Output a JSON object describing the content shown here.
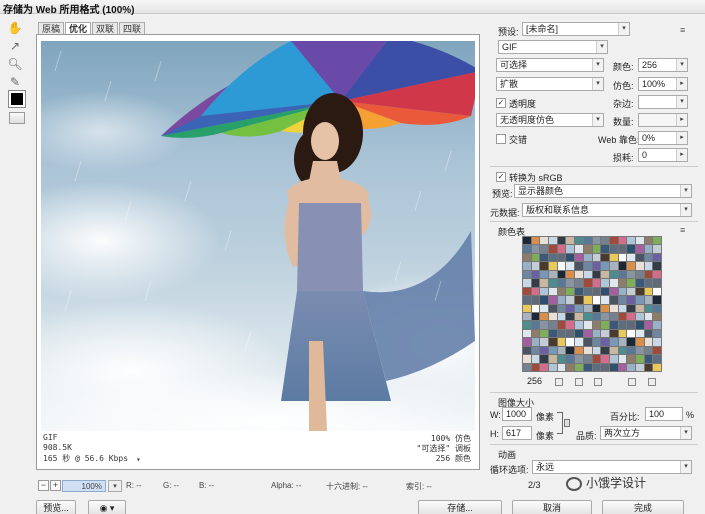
{
  "window": {
    "title": "存储为 Web 所用格式 (100%)"
  },
  "tools": [
    "hand-tool",
    "slice-select-tool",
    "zoom-tool",
    "eyedropper-tool"
  ],
  "tabs": [
    {
      "label": "原稿",
      "active": false
    },
    {
      "label": "优化",
      "active": true
    },
    {
      "label": "双联",
      "active": false
    },
    {
      "label": "四联",
      "active": false
    }
  ],
  "image_info": {
    "format": "GIF",
    "size": "908.5K",
    "time": "165 秒 @ 56.6 Kbps",
    "dither_pct": "100% 仿色",
    "palette": "\"可选择\" 调板",
    "colors": "256 颜色"
  },
  "status": {
    "zoom": "100%",
    "r": "R: --",
    "g": "G: --",
    "b": "B: --",
    "alpha": "Alpha: --",
    "hex": "十六进制: --",
    "index": "索引: --"
  },
  "bottom_buttons": {
    "preview": "预览...",
    "save": "存储...",
    "cancel": "取消",
    "done": "完成"
  },
  "settings": {
    "preset_label": "预设:",
    "preset_value": "[未命名]",
    "format": "GIF",
    "reduction": "可选择",
    "dither_algo": "扩散",
    "colors_label": "颜色:",
    "colors_value": "256",
    "dither_label": "仿色:",
    "dither_value": "100%",
    "transparency_label": "透明度",
    "transparency_checked": true,
    "matte_label": "杂边:",
    "trans_dither": "无透明度仿色",
    "amount_label": "数量:",
    "interlaced_label": "交错",
    "interlaced_checked": false,
    "websnap_label": "Web 靠色:",
    "websnap_value": "0%",
    "lossy_label": "损耗:",
    "lossy_value": "0",
    "convert_srgb_label": "转换为 sRGB",
    "convert_srgb_checked": true,
    "preview_label": "预览:",
    "preview_value": "显示器颜色",
    "metadata_label": "元数据:",
    "metadata_value": "版权和联系信息"
  },
  "color_table": {
    "title": "颜色表",
    "count": "256",
    "colors": [
      "#1c2836",
      "#4b3a2e",
      "#8c7d6a",
      "#c9b8a1",
      "#6e86a0",
      "#2f4f6e",
      "#a04a3b",
      "#d98e4a",
      "#e8c95a",
      "#7fae5b",
      "#4d8d8f",
      "#6b5fa6",
      "#a35fa0",
      "#d66c8c",
      "#e8e0d6",
      "#fdfdfd",
      "#3a5878",
      "#587898",
      "#7898b8",
      "#98b0c8",
      "#b0c4d8",
      "#c8d8e6",
      "#dde7ef",
      "#5d6e7e",
      "#8795a3",
      "#a7b3bf",
      "#c3cdd6",
      "#e0e6eb",
      "#343c48",
      "#4a5462",
      "#606a78",
      "#76808e"
    ],
    "meta_label": "",
    "icons": [
      "map-to-web-icon",
      "lock-color-icon",
      "web-shift-icon",
      "new-color-icon",
      "delete-color-icon"
    ]
  },
  "image_size": {
    "title": "图像大小",
    "w_label": "W:",
    "w_value": "1000",
    "h_label": "H:",
    "h_value": "617",
    "unit": "像素",
    "percent_label": "百分比:",
    "percent_value": "100",
    "percent_unit": "%",
    "quality_label": "品质:",
    "quality_value": "两次立方"
  },
  "animation": {
    "title": "动画",
    "loop_label": "循环选项:",
    "loop_value": "永远",
    "frame": "2/3"
  },
  "watermark": "小饿学设计"
}
